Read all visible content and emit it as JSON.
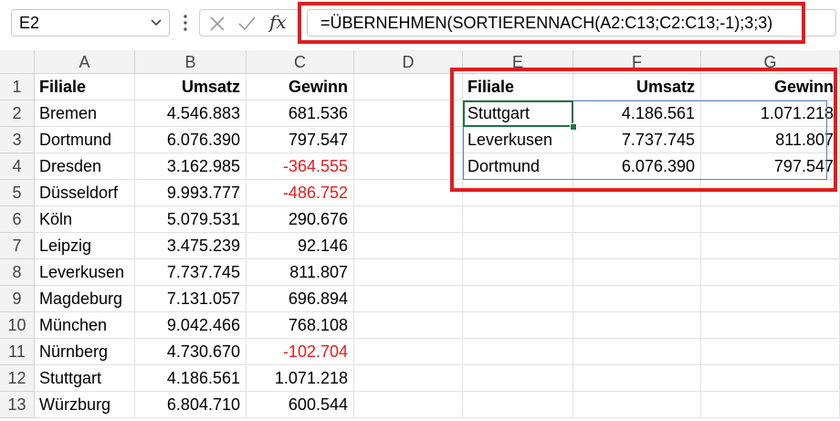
{
  "name_box": {
    "value": "E2"
  },
  "formula_bar": {
    "fx_label": "fx",
    "formula": "=ÜBERNEHMEN(SORTIERENNACH(A2:C13;C2:C13;-1);3;3)"
  },
  "columns": [
    "A",
    "B",
    "C",
    "D",
    "E",
    "F",
    "G"
  ],
  "rows": [
    "1",
    "2",
    "3",
    "4",
    "5",
    "6",
    "7",
    "8",
    "9",
    "10",
    "11",
    "12",
    "13"
  ],
  "source_table": {
    "headers": [
      "Filiale",
      "Umsatz",
      "Gewinn"
    ],
    "rows": [
      {
        "filiale": "Bremen",
        "umsatz": "4.546.883",
        "gewinn": "681.536",
        "negative": false
      },
      {
        "filiale": "Dortmund",
        "umsatz": "6.076.390",
        "gewinn": "797.547",
        "negative": false
      },
      {
        "filiale": "Dresden",
        "umsatz": "3.162.985",
        "gewinn": "-364.555",
        "negative": true
      },
      {
        "filiale": "Düsseldorf",
        "umsatz": "9.993.777",
        "gewinn": "-486.752",
        "negative": true
      },
      {
        "filiale": "Köln",
        "umsatz": "5.079.531",
        "gewinn": "290.676",
        "negative": false
      },
      {
        "filiale": "Leipzig",
        "umsatz": "3.475.239",
        "gewinn": "92.146",
        "negative": false
      },
      {
        "filiale": "Leverkusen",
        "umsatz": "7.737.745",
        "gewinn": "811.807",
        "negative": false
      },
      {
        "filiale": "Magdeburg",
        "umsatz": "7.131.057",
        "gewinn": "696.894",
        "negative": false
      },
      {
        "filiale": "München",
        "umsatz": "9.042.466",
        "gewinn": "768.108",
        "negative": false
      },
      {
        "filiale": "Nürnberg",
        "umsatz": "4.730.670",
        "gewinn": "-102.704",
        "negative": true
      },
      {
        "filiale": "Stuttgart",
        "umsatz": "4.186.561",
        "gewinn": "1.071.218",
        "negative": false
      },
      {
        "filiale": "Würzburg",
        "umsatz": "6.804.710",
        "gewinn": "600.544",
        "negative": false
      }
    ]
  },
  "result_table": {
    "headers": [
      "Filiale",
      "Umsatz",
      "Gewinn"
    ],
    "rows": [
      {
        "filiale": "Stuttgart",
        "umsatz": "4.186.561",
        "gewinn": "1.071.218"
      },
      {
        "filiale": "Leverkusen",
        "umsatz": "7.737.745",
        "gewinn": "811.807"
      },
      {
        "filiale": "Dortmund",
        "umsatz": "6.076.390",
        "gewinn": "797.547"
      }
    ]
  },
  "colors": {
    "highlight_border": "#e01e1e",
    "negative_text": "#e01e1e",
    "active_cell_border": "#1e7145",
    "spill_border": "#4f86c6"
  },
  "icons": [
    "dropdown-arrow-icon",
    "more-options-icon",
    "cancel-icon",
    "enter-icon",
    "function-icon"
  ]
}
